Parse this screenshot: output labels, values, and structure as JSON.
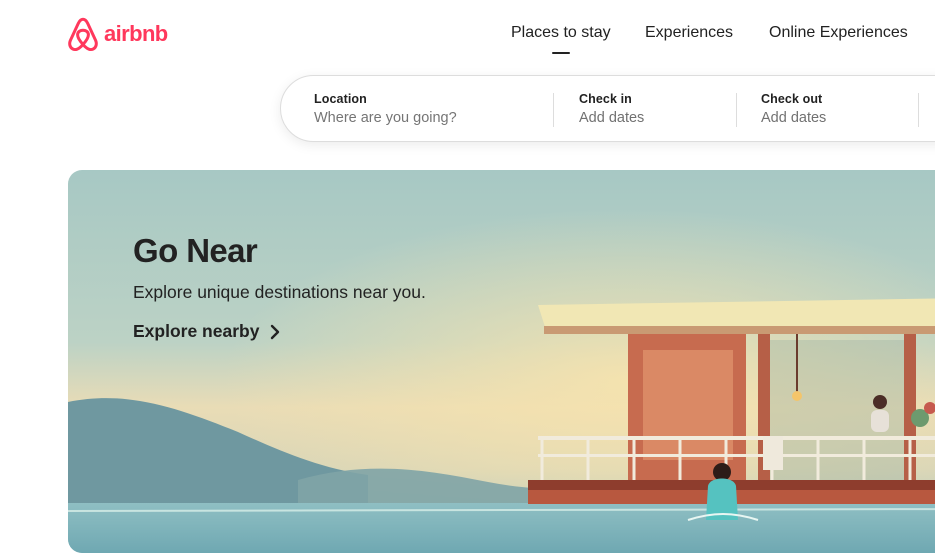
{
  "brand": {
    "name": "airbnb",
    "color": "#ff385c",
    "logo_icon": "airbnb-belo-icon"
  },
  "nav": {
    "tabs": [
      {
        "label": "Places to stay",
        "active": true
      },
      {
        "label": "Experiences",
        "active": false
      },
      {
        "label": "Online Experiences",
        "active": false
      }
    ]
  },
  "search": {
    "location": {
      "label": "Location",
      "placeholder": "Where are you going?"
    },
    "check_in": {
      "label": "Check in",
      "placeholder": "Add dates"
    },
    "check_out": {
      "label": "Check out",
      "placeholder": "Add dates"
    }
  },
  "hero": {
    "title": "Go Near",
    "subtitle": "Explore unique destinations near you.",
    "link_label": "Explore nearby",
    "link_icon": "chevron-right-icon",
    "image": "illustration of a person wading in a lake beside a houseboat at sunset"
  }
}
